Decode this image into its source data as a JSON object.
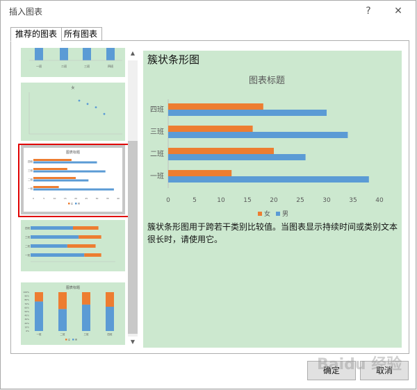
{
  "window": {
    "title": "插入图表",
    "help_label": "?",
    "close_label": "✕"
  },
  "tabs": [
    {
      "label": "推荐的图表"
    },
    {
      "label": "所有图表"
    }
  ],
  "preview": {
    "heading": "簇状条形图",
    "description": "簇状条形图用于跨若干类别比较值。当图表显示持续时间或类别文本很长时，请使用它。"
  },
  "chart_data": {
    "type": "bar",
    "orientation": "horizontal",
    "title": "图表标题",
    "categories": [
      "一班",
      "二班",
      "三班",
      "四班"
    ],
    "series": [
      {
        "name": "女",
        "values": [
          12,
          20,
          16,
          18
        ],
        "color": "#ed7d31"
      },
      {
        "name": "男",
        "values": [
          38,
          26,
          34,
          30
        ],
        "color": "#5b9bd5"
      }
    ],
    "xlim": [
      0,
      40
    ],
    "ticks": [
      0,
      5,
      10,
      15,
      20,
      25,
      30,
      35,
      40
    ],
    "legend": "bottom",
    "grid": false
  },
  "thumbnails": {
    "column_categories": [
      "一班",
      "二班",
      "三班",
      "四班"
    ],
    "scatter_title": "女",
    "scatter_points": [
      [
        30,
        20
      ],
      [
        35,
        18
      ],
      [
        40,
        16
      ],
      [
        45,
        12
      ]
    ],
    "stacked_title": "图表标题",
    "stacked_percent_labels": [
      "100%",
      "90%",
      "80%",
      "70%",
      "60%",
      "50%",
      "40%",
      "30%",
      "20%",
      "10%",
      "0%"
    ]
  },
  "buttons": {
    "ok_label": "确定",
    "cancel_label": "取消"
  },
  "watermark": "Baidu 经验"
}
